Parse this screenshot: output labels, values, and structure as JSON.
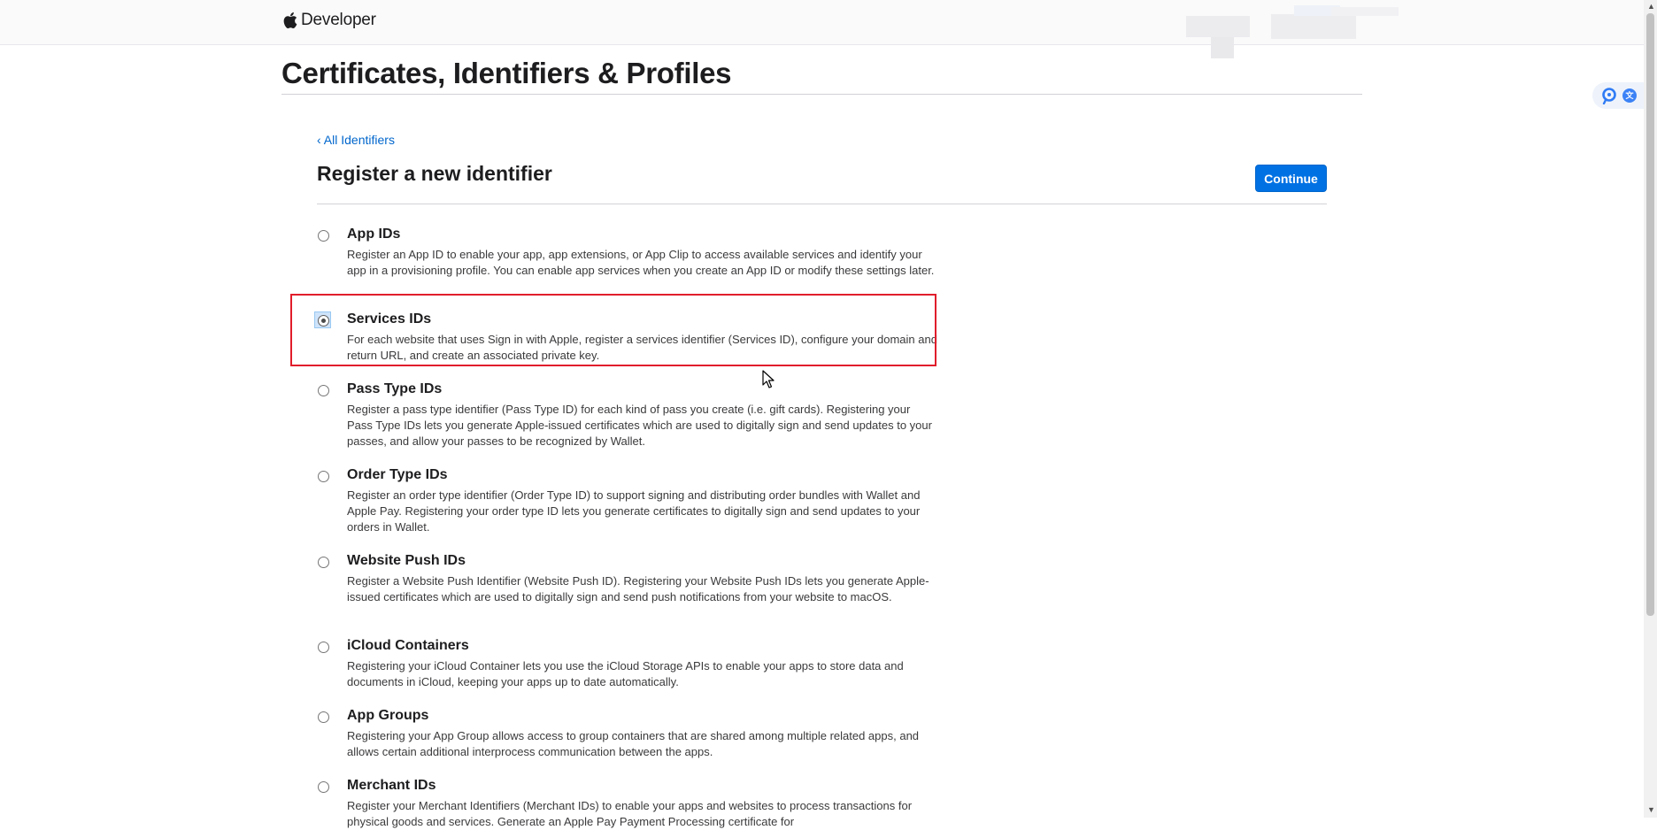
{
  "header": {
    "brand": "Developer"
  },
  "page": {
    "title": "Certificates, Identifiers & Profiles",
    "back_link": "All Identifiers",
    "back_chevron": "‹",
    "section_title": "Register a new identifier",
    "continue_label": "Continue"
  },
  "options": [
    {
      "name": "App IDs",
      "desc": "Register an App ID to enable your app, app extensions, or App Clip to access available services and identify your app in a provisioning profile. You can enable app services when you create an App ID or modify these settings later.",
      "selected": false
    },
    {
      "name": "Services IDs",
      "desc": "For each website that uses Sign in with Apple, register a services identifier (Services ID), configure your domain and return URL, and create an associated private key.",
      "selected": true
    },
    {
      "name": "Pass Type IDs",
      "desc": "Register a pass type identifier (Pass Type ID) for each kind of pass you create (i.e. gift cards). Registering your Pass Type IDs lets you generate Apple-issued certificates which are used to digitally sign and send updates to your passes, and allow your passes to be recognized by Wallet.",
      "selected": false
    },
    {
      "name": "Order Type IDs",
      "desc": "Register an order type identifier (Order Type ID) to support signing and distributing order bundles with Wallet and Apple Pay. Registering your order type ID lets you generate certificates to digitally sign and send updates to your orders in Wallet.",
      "selected": false
    },
    {
      "name": "Website Push IDs",
      "desc": "Register a Website Push Identifier (Website Push ID). Registering your Website Push IDs lets you generate Apple-issued certificates which are used to digitally sign and send push notifications from your website to macOS.",
      "selected": false
    },
    {
      "name": "iCloud Containers",
      "desc": "Registering your iCloud Container lets you use the iCloud Storage APIs to enable your apps to store data and documents in iCloud, keeping your apps up to date automatically.",
      "selected": false
    },
    {
      "name": "App Groups",
      "desc": "Registering your App Group allows access to group containers that are shared among multiple related apps, and allows certain additional interprocess communication between the apps.",
      "selected": false
    },
    {
      "name": "Merchant IDs",
      "desc": "Register your Merchant Identifiers (Merchant IDs) to enable your apps and websites to process transactions for physical goods and services. Generate an Apple Pay Payment Processing certificate for",
      "selected": false
    }
  ],
  "icons": {
    "brand": "apple-logo-icon",
    "cursor": "mouse-pointer-icon",
    "side_a": "assistant-icon",
    "side_b": "translate-icon"
  },
  "colors": {
    "link": "#0066cc",
    "button": "#0071e3",
    "highlight": "#e11d2b"
  }
}
